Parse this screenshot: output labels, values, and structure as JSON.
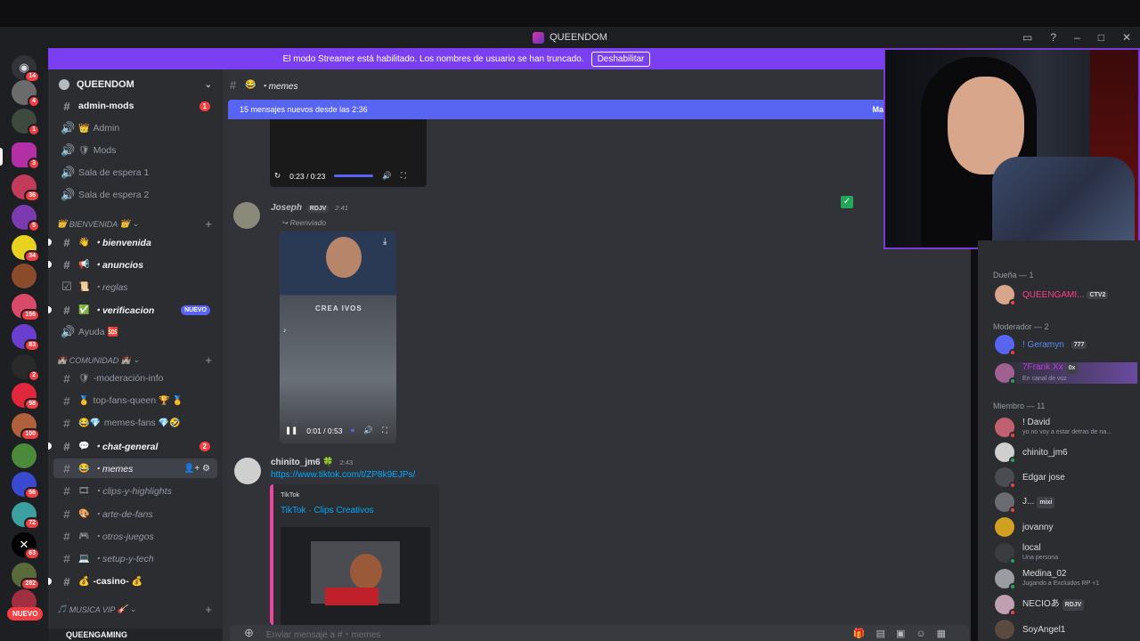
{
  "window": {
    "title": "QUEENDOM"
  },
  "streamer_banner": {
    "text": "El modo Streamer está habilitado. Los nombres de usuario se han truncado.",
    "button": "Deshabilitar"
  },
  "rail": {
    "badges": [
      "14",
      "4",
      "1",
      "3",
      "36",
      "5",
      "34",
      "156",
      "83",
      "2",
      "98",
      "100",
      "56",
      "72",
      "63",
      "282"
    ],
    "new_label": "NUEVO"
  },
  "server": {
    "name": "QUEENDOM"
  },
  "channels": {
    "admin_mods": "admin-mods",
    "admin_mods_badge": "1",
    "admin": "Admin",
    "mods": "Mods",
    "espera1": "Sala de espera 1",
    "espera2": "Sala de espera 2",
    "cat_bienvenida": "BIENVENIDA",
    "bienvenida": "・bienvenida",
    "anuncios": "・anuncios",
    "reglas": "・reglas",
    "verificacion": "・verificacion",
    "verificacion_badge": "NUEVO",
    "ayuda": "Ayuda",
    "cat_comunidad": "COMUNIDAD",
    "moderacion": "-moderación-info",
    "topfans": "top-fans-queen",
    "memesfans": "memes-fans",
    "chatgeneral": "・chat-general",
    "chatgeneral_badge": "2",
    "memes": "・memes",
    "clips": "・clips-y-highlights",
    "arte": "・arte-de-fans",
    "otros": "・otros-juegos",
    "setup": "・setup-y-tech",
    "casino": "-casino-",
    "cat_musica": "MUSICA VIP"
  },
  "user_panel": {
    "name": "QUEENGAMING"
  },
  "chat": {
    "channel_name": "・memes",
    "new_messages": "15 mensajes nuevos desde las 2:36",
    "new_messages_right": "Ma",
    "video1_time": "0:23 / 0:23",
    "msg1": {
      "author": "Joseph",
      "tag": "RDJV",
      "time": "2:41",
      "forwarded": "Reenviado",
      "video_time": "0:01 / 0:53",
      "video_caption": "CREA IVOS"
    },
    "msg2": {
      "author": "chinito_jm6",
      "time": "2:43",
      "link": "https://www.tiktok.com/t/ZP8k9EJPs/",
      "embed_provider": "TikTok",
      "embed_title": "TikTok · Clips Creativos"
    },
    "composer_placeholder": "Enviar mensaje a #・memes"
  },
  "members": {
    "owner_group": "Dueña — 1",
    "owner": {
      "name": "QUEENGAMI...",
      "tag": "CTV2"
    },
    "mod_group": "Moderador — 2",
    "mod1": {
      "name": "! Geramyn",
      "tag": "777"
    },
    "mod2": {
      "name": "7Frank Xx",
      "tag": "0x",
      "sub": "En canal de voz"
    },
    "member_group": "Miembro — 11",
    "list": [
      {
        "name": "! David",
        "sub": "yo no voy a estar detras de na..."
      },
      {
        "name": "chinito_jm6",
        "sub": ""
      },
      {
        "name": "Edgar jose",
        "sub": ""
      },
      {
        "name": "J...",
        "sub": "",
        "tag": "mixi"
      },
      {
        "name": "jovanny",
        "sub": ""
      },
      {
        "name": "local",
        "sub": "Una persona"
      },
      {
        "name": "Medina_02",
        "sub": "Jugando a Excluidos RP +1"
      },
      {
        "name": "NECIOあ",
        "sub": "",
        "tag": "RDJV"
      },
      {
        "name": "SoyAngel1",
        "sub": ""
      }
    ]
  },
  "colors": {
    "accent": "#5865f2",
    "streamer": "#7b3ff2",
    "unread": "#f23f43",
    "owner": "#ff3b8b",
    "mod": "#5b8def",
    "frank": "#c13bd6",
    "author1": "#b9bbbe",
    "link": "#00a8fc",
    "embed_title": "#00a8fc"
  }
}
